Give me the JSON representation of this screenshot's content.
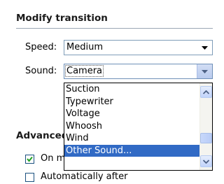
{
  "panel": {
    "title": "Modify transition",
    "speed": {
      "label": "Speed:",
      "value": "Medium"
    },
    "sound": {
      "label": "Sound:",
      "value": "Camera"
    }
  },
  "advanced": {
    "title": "Advanced",
    "on_click_label": "On mouse click",
    "on_click_checked": true,
    "auto_label": "Automatically after",
    "auto_checked": false
  },
  "sound_dropdown": {
    "options": [
      "Suction",
      "Typewriter",
      "Voltage",
      "Whoosh",
      "Wind",
      "Other Sound..."
    ],
    "selected": "Other Sound..."
  },
  "icons": {
    "combo_arrow": "chevron-down-icon",
    "scroll_up": "scroll-up-arrow-icon",
    "scroll_down": "scroll-down-arrow-icon",
    "checkmark": "checkmark-icon"
  },
  "colors": {
    "selection": "#316ac5",
    "combo_border": "#7f9db9",
    "scroll_button": "#c1d3fb"
  }
}
